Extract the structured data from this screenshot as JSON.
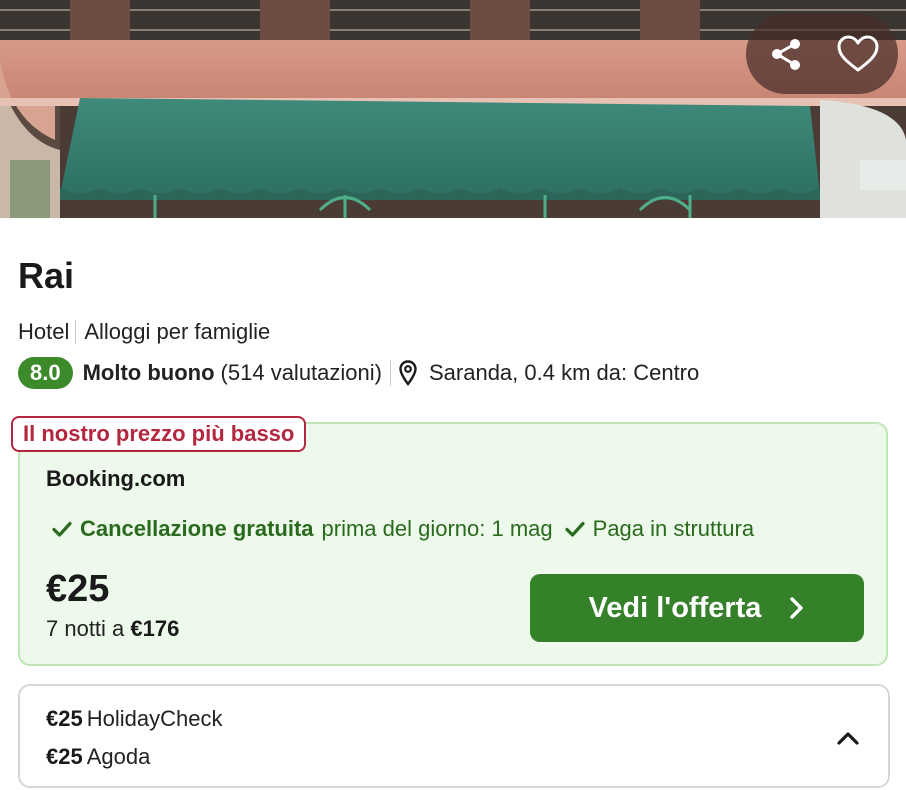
{
  "hotel": {
    "name": "Rai",
    "type": "Hotel",
    "category": "Alloggi per famiglie",
    "score": "8.0",
    "rating_label": "Molto buono",
    "reviews": "(514 valutazioni)",
    "location": "Saranda, 0.4 km da: Centro"
  },
  "deal": {
    "tag": "Il nostro prezzo più basso",
    "provider": "Booking.com",
    "free_cancellation": "Cancellazione gratuita",
    "cancellation_until": "prima del giorno: 1 mag",
    "pay_at_property": "Paga in struttura",
    "price": "€25",
    "nights_text": "7 notti a",
    "total": "€176",
    "cta": "Vedi l'offerta"
  },
  "other_offers": [
    {
      "price": "€25",
      "provider": "HolidayCheck"
    },
    {
      "price": "€25",
      "provider": "Agoda"
    }
  ],
  "icons": {
    "share": "share-icon",
    "favorite": "heart-icon",
    "location": "map-pin-icon",
    "check": "checkmark-icon",
    "cta_arrow": "chevron-right-icon",
    "collapse": "chevron-up-icon"
  },
  "colors": {
    "score_badge": "#3c8a2a",
    "deal_background": "#edf9ea",
    "deal_border": "#bfe6b5",
    "tag_accent": "#b3273f",
    "cta_button": "#35812a",
    "feature_text": "#2a6a1e"
  }
}
